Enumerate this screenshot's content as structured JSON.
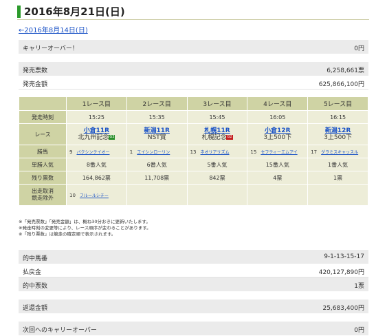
{
  "title": "2016年8月21日(日)",
  "back_link": "←2016年8月14日(日)",
  "carryover": {
    "label": "キャリーオーバー！",
    "value": "0円"
  },
  "sales": [
    {
      "label": "発売票数",
      "value": "6,258,661票"
    },
    {
      "label": "発売金額",
      "value": "625,866,100円"
    }
  ],
  "races": {
    "headers": [
      "1レース目",
      "2レース目",
      "3レース目",
      "4レース目",
      "5レース目"
    ],
    "row_labels": {
      "time": "発走時刻",
      "race": "レース",
      "winner": "勝馬",
      "popularity": "単勝人気",
      "remaining": "残り票数",
      "scratched_line1": "出走取消",
      "scratched_line2": "競走除外"
    },
    "times": [
      "15:25",
      "15:35",
      "15:45",
      "16:05",
      "16:15"
    ],
    "race_names": [
      "小倉11R",
      "新潟11R",
      "札幌11R",
      "小倉12R",
      "新潟12R"
    ],
    "race_subs": [
      "北九州記念",
      "NST賞",
      "札幌記念",
      "3上500下",
      "3上500下"
    ],
    "badges": [
      "G3",
      "",
      "G2",
      "",
      ""
    ],
    "winner_nums": [
      "9",
      "1",
      "13",
      "15",
      "17"
    ],
    "winner_names": [
      "バクシンテイオー",
      "エイシンローリン",
      "ネオリアリズム",
      "セフティーエムアイ",
      "グラミスキャッスル"
    ],
    "popularity": [
      "8番人気",
      "6番人気",
      "5番人気",
      "15番人気",
      "1番人気"
    ],
    "remaining": [
      "164,862票",
      "11,708票",
      "842票",
      "4票",
      "1票"
    ],
    "scratched_num": "10",
    "scratched_name": "フルールシチー"
  },
  "notes": [
    "※「発売票数」「発売金額」は、概ね30分おきに更新いたします。",
    "※発走時刻の変更等により、レース順序が変わることがあります。",
    "※「残り票数」は競走の確定順で表示されます。"
  ],
  "results": [
    {
      "label": "的中馬番",
      "value": "9-1-13-15-17"
    },
    {
      "label": "払戻金",
      "value": "420,127,890円"
    },
    {
      "label": "的中票数",
      "value": "1票"
    }
  ],
  "refund": {
    "label": "返還金額",
    "value": "25,683,400円"
  },
  "next_carryover": {
    "label": "次回へのキャリーオーバー",
    "value": "0円"
  }
}
